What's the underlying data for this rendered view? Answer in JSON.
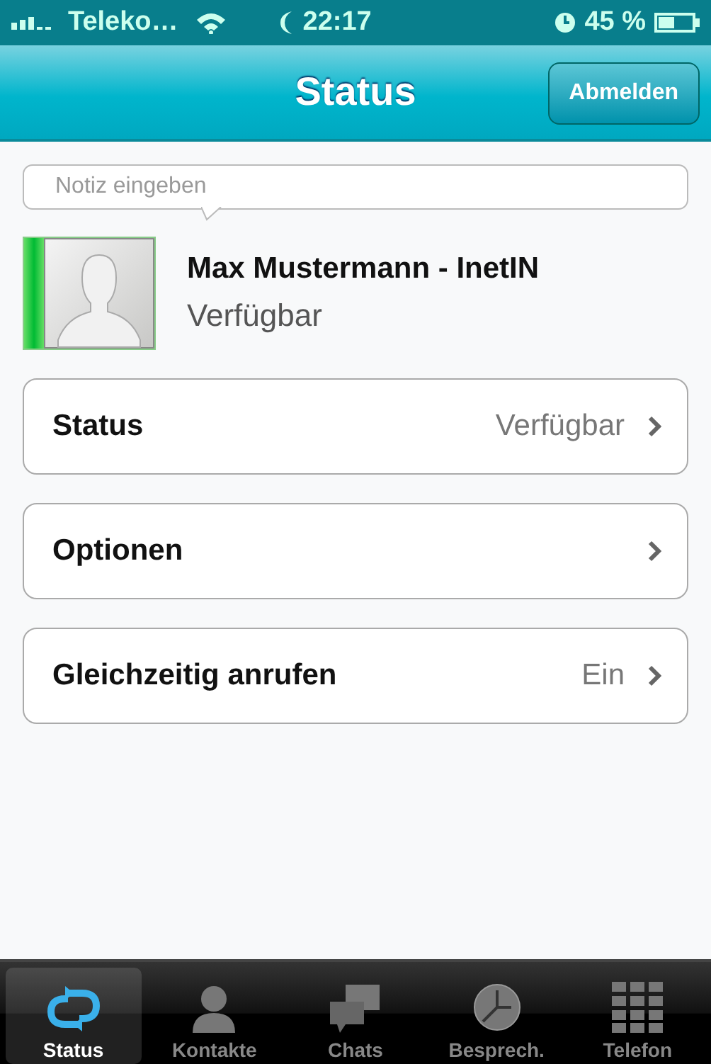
{
  "status_bar": {
    "carrier": "Teleko…",
    "time": "22:17",
    "battery": "45 %"
  },
  "nav": {
    "title": "Status",
    "button": "Abmelden"
  },
  "note": {
    "placeholder": "Notiz eingeben"
  },
  "profile": {
    "name": "Max Mustermann - InetIN",
    "status": "Verfügbar",
    "online": true
  },
  "rows": [
    {
      "label": "Status",
      "value": "Verfügbar"
    },
    {
      "label": "Optionen"
    },
    {
      "label": "Gleichzeitig anrufen",
      "value": "Ein"
    }
  ],
  "tabs": [
    {
      "label": "Status",
      "selected": true
    },
    {
      "label": "Kontakte",
      "selected": false
    },
    {
      "label": "Chats",
      "selected": false
    },
    {
      "label": "Besprech.",
      "selected": false
    },
    {
      "label": "Telefon",
      "selected": false
    }
  ]
}
